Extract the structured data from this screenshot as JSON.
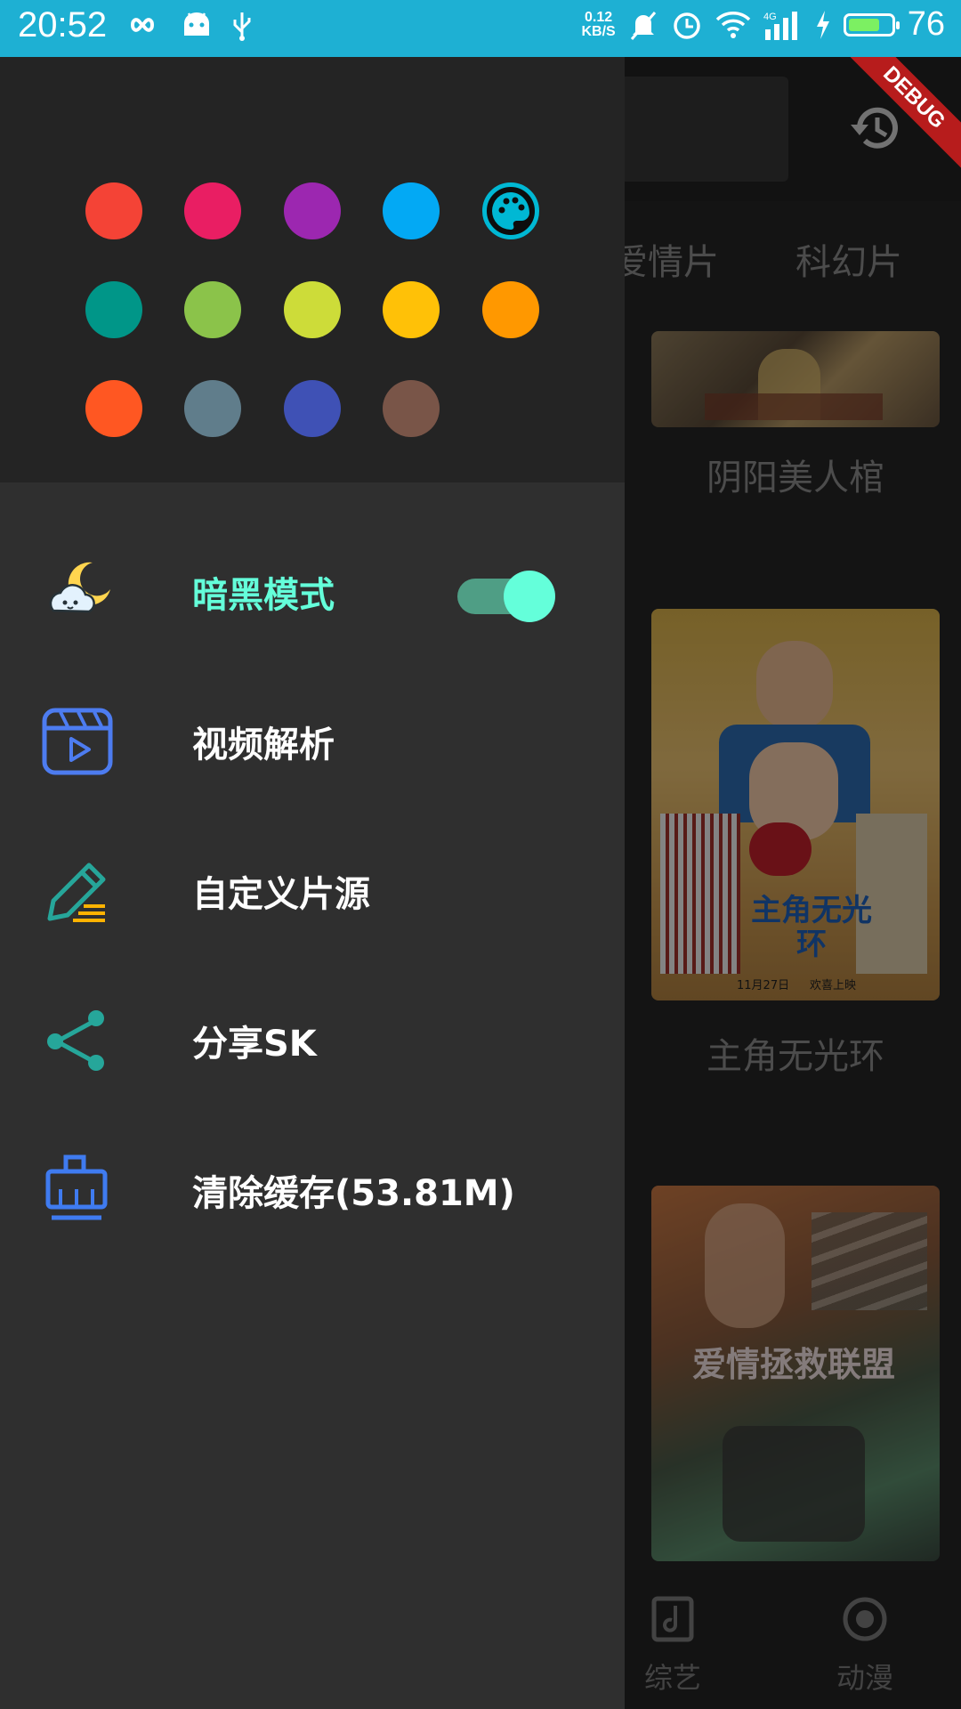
{
  "status_bar": {
    "time": "20:52",
    "net_speed_value": "0.12",
    "net_speed_unit": "KB/S",
    "network_type": "4G",
    "battery_percent": "76",
    "battery_level": 0.76,
    "bg_color": "#1eb0d3"
  },
  "debug_banner": "DEBUG",
  "background_app": {
    "tabs": [
      "爱情片",
      "科幻片"
    ],
    "posters": [
      {
        "title": "阴阳美人棺"
      },
      {
        "title": "主角无光环",
        "poster_text": "主角无光环",
        "poster_date": "11月27日",
        "poster_release": "欢喜上映"
      },
      {
        "title": "",
        "poster_text": "爱情拯救联盟"
      }
    ],
    "bottom_nav": [
      "综艺",
      "动漫"
    ]
  },
  "drawer": {
    "theme_colors": [
      "#f44336",
      "#e91e63",
      "#9c27b0",
      "#03a9f4",
      "#009688",
      "#8bc34a",
      "#cddc39",
      "#ffc107",
      "#ff9800",
      "#ff5722",
      "#607d8b",
      "#3f51b5",
      "#795548"
    ],
    "palette_icon": "palette-icon",
    "menu": [
      {
        "label": "暗黑模式",
        "icon": "moon-cloud-icon",
        "color": "#64ffda",
        "toggle_on": true
      },
      {
        "label": "视频解析",
        "icon": "video-clapper-icon"
      },
      {
        "label": "自定义片源",
        "icon": "pencil-edit-icon"
      },
      {
        "label": "分享SK",
        "icon": "share-icon"
      },
      {
        "label": "清除缓存(53.81M)",
        "icon": "broom-icon"
      }
    ]
  }
}
